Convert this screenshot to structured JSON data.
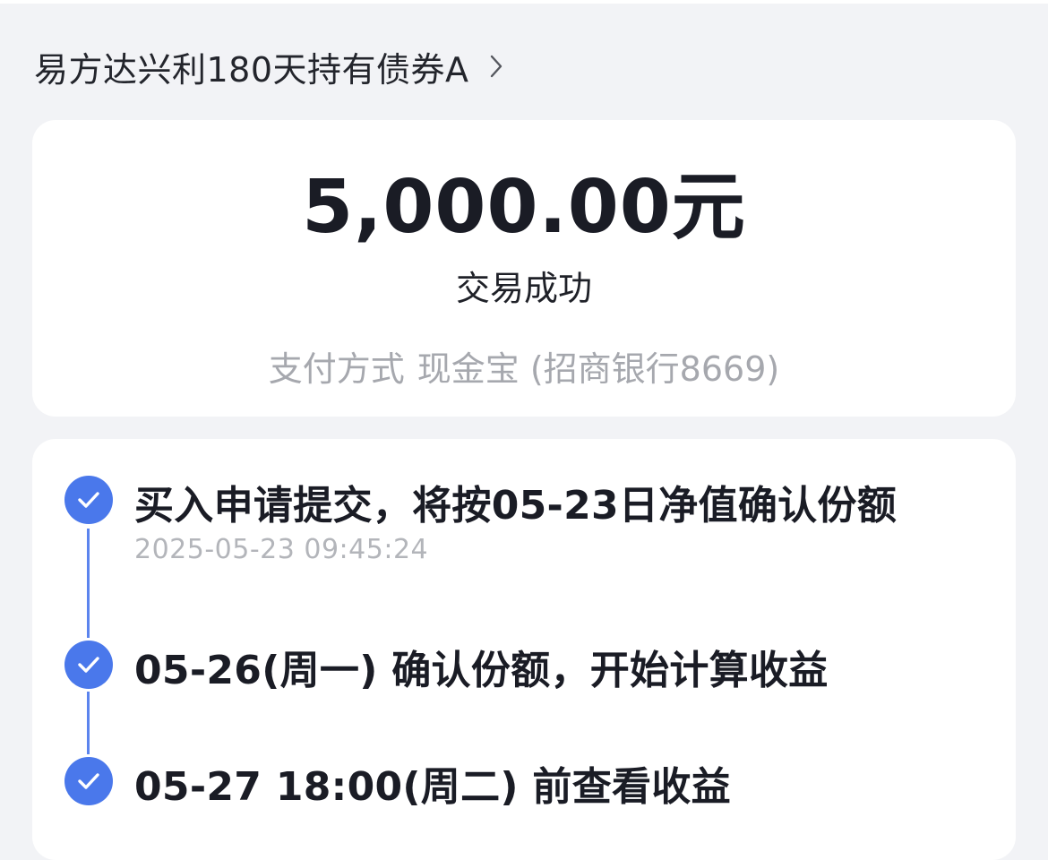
{
  "fund": {
    "name": "易方达兴利180天持有债券A"
  },
  "summary": {
    "amount": "5,000.00元",
    "status": "交易成功",
    "payment_label": "支付方式",
    "payment_value": "现金宝 (招商银行8669)"
  },
  "timeline": {
    "steps": [
      {
        "text": "买入申请提交，将按05-23日净值确认份额",
        "time": "2025-05-23 09:45:24"
      },
      {
        "text": "05-26(周一) 确认份额，开始计算收益"
      },
      {
        "text": "05-27 18:00(周二) 前查看收益"
      }
    ]
  },
  "colors": {
    "accent": "#4a78eb",
    "background": "#f2f3f6",
    "card": "#ffffff",
    "muted_text": "#a6a8ae"
  }
}
